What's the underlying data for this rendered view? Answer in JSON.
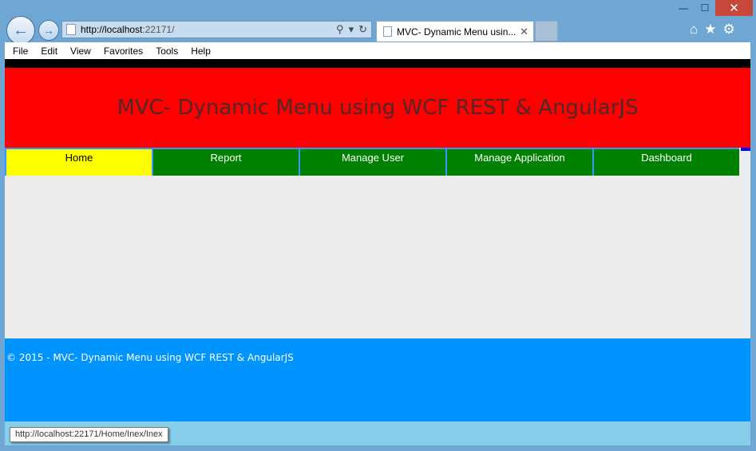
{
  "browser": {
    "window_controls": {
      "minimize": "—",
      "maximize": "☐",
      "close": "✕"
    },
    "address": {
      "host": "http://localhost",
      "rest": ":22171/"
    },
    "tab": {
      "title": "MVC- Dynamic Menu usin...",
      "close": "✕"
    },
    "icons": [
      "home-icon",
      "favorites-star-icon",
      "settings-gear-icon"
    ]
  },
  "menubar": {
    "items": [
      "File",
      "Edit",
      "View",
      "Favorites",
      "Tools",
      "Help"
    ]
  },
  "site": {
    "title": "MVC- Dynamic Menu using WCF REST & AngularJS",
    "nav": [
      {
        "label": "Home",
        "active": true
      },
      {
        "label": "Report",
        "active": false
      },
      {
        "label": "Manage User",
        "active": false
      },
      {
        "label": "Manage Application",
        "active": false
      },
      {
        "label": "Dashboard",
        "active": false
      }
    ],
    "footer": "© 2015 - MVC- Dynamic Menu using WCF REST & AngularJS"
  },
  "status": {
    "hover_url": "http://localhost:22171/Home/Inex/Inex"
  },
  "colors": {
    "header": "#ff0000",
    "nav_bg": "#008000",
    "nav_active": "#ffff00",
    "footer": "#0094ff",
    "status": "#87ceeb"
  }
}
